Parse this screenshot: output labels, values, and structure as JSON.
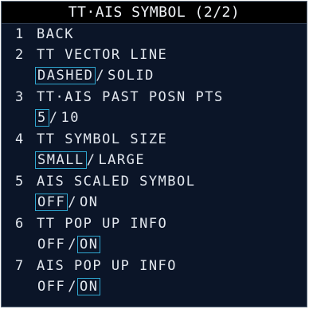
{
  "title": "TT·AIS SYMBOL (2/2)",
  "items": [
    {
      "num": "1",
      "label": "BACK"
    },
    {
      "num": "2",
      "label": "TT VECTOR LINE",
      "options": [
        {
          "label": "DASHED",
          "selected": true
        },
        {
          "label": "SOLID",
          "selected": false
        }
      ]
    },
    {
      "num": "3",
      "label": "TT·AIS PAST POSN PTS",
      "options": [
        {
          "label": "5",
          "selected": true
        },
        {
          "label": "10",
          "selected": false
        }
      ]
    },
    {
      "num": "4",
      "label": "TT SYMBOL SIZE",
      "options": [
        {
          "label": "SMALL",
          "selected": true
        },
        {
          "label": "LARGE",
          "selected": false
        }
      ]
    },
    {
      "num": "5",
      "label": "AIS SCALED SYMBOL",
      "options": [
        {
          "label": "OFF",
          "selected": true
        },
        {
          "label": "ON",
          "selected": false
        }
      ]
    },
    {
      "num": "6",
      "label": "TT POP UP INFO",
      "options": [
        {
          "label": "OFF",
          "selected": false
        },
        {
          "label": "ON",
          "selected": true
        }
      ]
    },
    {
      "num": "7",
      "label": "AIS POP UP INFO",
      "options": [
        {
          "label": "OFF",
          "selected": false
        },
        {
          "label": "ON",
          "selected": true
        }
      ]
    }
  ],
  "separator": "/",
  "colors": {
    "background": "#0b1528",
    "title_background": "#000000",
    "text": "#e2e7ee",
    "selection_border": "#2fa6cf"
  }
}
